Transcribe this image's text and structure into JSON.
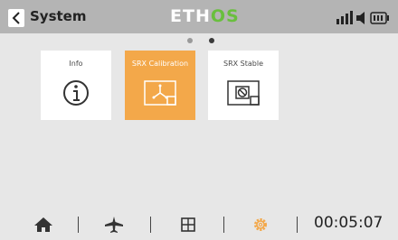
{
  "header": {
    "title": "System",
    "brand_prefix": "ETH",
    "brand_accent": "OS",
    "accent_color": "#69bf3e",
    "status_icons": [
      "signal-icon",
      "volume-icon",
      "battery-icon"
    ]
  },
  "pager": {
    "page_count": 2,
    "current_page": 2
  },
  "cards": [
    {
      "label": "Info",
      "icon": "info-icon",
      "active": false
    },
    {
      "label": "SRX Calibration",
      "icon": "calibration-icon",
      "active": true
    },
    {
      "label": "SRX Stable",
      "icon": "stable-icon",
      "active": false
    }
  ],
  "highlight_color": "#f3a84a",
  "footer": {
    "buttons": [
      "home-icon",
      "model-icon",
      "widgets-icon",
      "settings-icon"
    ],
    "active_button": "settings-icon",
    "clock": "00:05:07"
  }
}
